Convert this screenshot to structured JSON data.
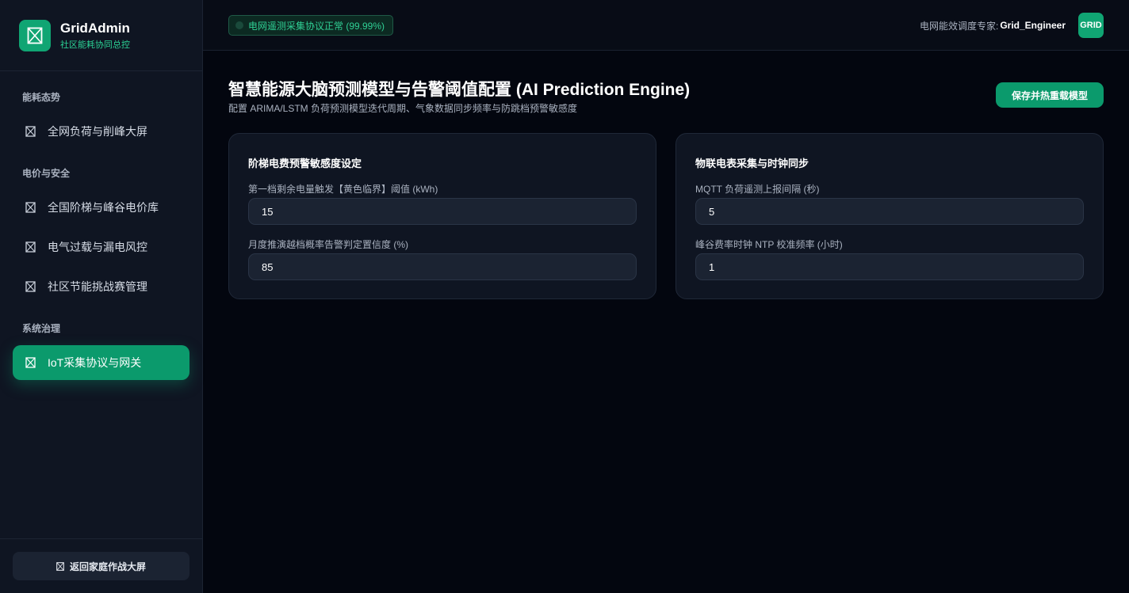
{
  "brand": {
    "name": "GridAdmin",
    "subtitle": "社区能耗协同总控"
  },
  "sidebar": {
    "groups": [
      {
        "title": "能耗态势"
      },
      {
        "title": "电价与安全"
      },
      {
        "title": "系统治理"
      }
    ],
    "items": [
      {
        "label": "全网负荷与削峰大屏"
      },
      {
        "label": "全国阶梯与峰谷电价库"
      },
      {
        "label": "电气过载与漏电风控"
      },
      {
        "label": "社区节能挑战赛管理"
      },
      {
        "label": "IoT采集协议与网关",
        "active": true
      }
    ],
    "back_label": "返回家庭作战大屏"
  },
  "header": {
    "status": "电网遥测采集协议正常 (99.99%)",
    "user_label": "电网能效调度专家:",
    "user_name": "Grid_Engineer",
    "avatar_text": "GRID"
  },
  "main": {
    "title": "智慧能源大脑预测模型与告警阈值配置 (AI Prediction Engine)",
    "subtitle": "配置 ARIMA/LSTM 负荷预测模型迭代周期、气象数据同步频率与防跳档预警敏感度",
    "save_label": "保存并热重载模型",
    "cards": [
      {
        "title": "阶梯电费预警敏感度设定",
        "fields": [
          {
            "label": "第一档剩余电量触发【黄色临界】阈值 (kWh)",
            "value": "15"
          },
          {
            "label": "月度推演越档概率告警判定置信度 (%)",
            "value": "85"
          }
        ]
      },
      {
        "title": "物联电表采集与时钟同步",
        "fields": [
          {
            "label": "MQTT 负荷遥测上报间隔 (秒)",
            "value": "5"
          },
          {
            "label": "峰谷费率时钟 NTP 校准频率 (小时)",
            "value": "1"
          }
        ]
      }
    ]
  },
  "colors": {
    "accent": "#0b9a6c",
    "background": "#03060f",
    "sidebar": "#0f1522"
  }
}
